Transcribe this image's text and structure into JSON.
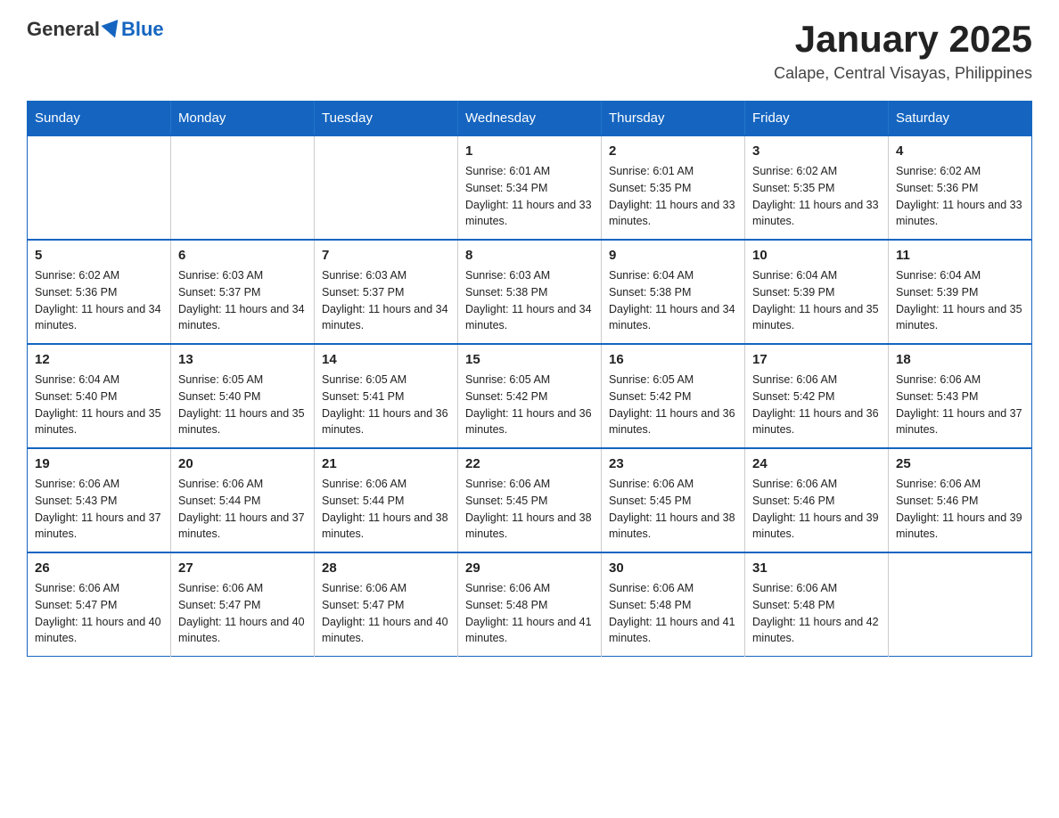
{
  "header": {
    "logo_text_general": "General",
    "logo_text_blue": "Blue",
    "main_title": "January 2025",
    "subtitle": "Calape, Central Visayas, Philippines"
  },
  "weekdays": [
    "Sunday",
    "Monday",
    "Tuesday",
    "Wednesday",
    "Thursday",
    "Friday",
    "Saturday"
  ],
  "weeks": [
    [
      {
        "day": "",
        "info": ""
      },
      {
        "day": "",
        "info": ""
      },
      {
        "day": "",
        "info": ""
      },
      {
        "day": "1",
        "info": "Sunrise: 6:01 AM\nSunset: 5:34 PM\nDaylight: 11 hours and 33 minutes."
      },
      {
        "day": "2",
        "info": "Sunrise: 6:01 AM\nSunset: 5:35 PM\nDaylight: 11 hours and 33 minutes."
      },
      {
        "day": "3",
        "info": "Sunrise: 6:02 AM\nSunset: 5:35 PM\nDaylight: 11 hours and 33 minutes."
      },
      {
        "day": "4",
        "info": "Sunrise: 6:02 AM\nSunset: 5:36 PM\nDaylight: 11 hours and 33 minutes."
      }
    ],
    [
      {
        "day": "5",
        "info": "Sunrise: 6:02 AM\nSunset: 5:36 PM\nDaylight: 11 hours and 34 minutes."
      },
      {
        "day": "6",
        "info": "Sunrise: 6:03 AM\nSunset: 5:37 PM\nDaylight: 11 hours and 34 minutes."
      },
      {
        "day": "7",
        "info": "Sunrise: 6:03 AM\nSunset: 5:37 PM\nDaylight: 11 hours and 34 minutes."
      },
      {
        "day": "8",
        "info": "Sunrise: 6:03 AM\nSunset: 5:38 PM\nDaylight: 11 hours and 34 minutes."
      },
      {
        "day": "9",
        "info": "Sunrise: 6:04 AM\nSunset: 5:38 PM\nDaylight: 11 hours and 34 minutes."
      },
      {
        "day": "10",
        "info": "Sunrise: 6:04 AM\nSunset: 5:39 PM\nDaylight: 11 hours and 35 minutes."
      },
      {
        "day": "11",
        "info": "Sunrise: 6:04 AM\nSunset: 5:39 PM\nDaylight: 11 hours and 35 minutes."
      }
    ],
    [
      {
        "day": "12",
        "info": "Sunrise: 6:04 AM\nSunset: 5:40 PM\nDaylight: 11 hours and 35 minutes."
      },
      {
        "day": "13",
        "info": "Sunrise: 6:05 AM\nSunset: 5:40 PM\nDaylight: 11 hours and 35 minutes."
      },
      {
        "day": "14",
        "info": "Sunrise: 6:05 AM\nSunset: 5:41 PM\nDaylight: 11 hours and 36 minutes."
      },
      {
        "day": "15",
        "info": "Sunrise: 6:05 AM\nSunset: 5:42 PM\nDaylight: 11 hours and 36 minutes."
      },
      {
        "day": "16",
        "info": "Sunrise: 6:05 AM\nSunset: 5:42 PM\nDaylight: 11 hours and 36 minutes."
      },
      {
        "day": "17",
        "info": "Sunrise: 6:06 AM\nSunset: 5:42 PM\nDaylight: 11 hours and 36 minutes."
      },
      {
        "day": "18",
        "info": "Sunrise: 6:06 AM\nSunset: 5:43 PM\nDaylight: 11 hours and 37 minutes."
      }
    ],
    [
      {
        "day": "19",
        "info": "Sunrise: 6:06 AM\nSunset: 5:43 PM\nDaylight: 11 hours and 37 minutes."
      },
      {
        "day": "20",
        "info": "Sunrise: 6:06 AM\nSunset: 5:44 PM\nDaylight: 11 hours and 37 minutes."
      },
      {
        "day": "21",
        "info": "Sunrise: 6:06 AM\nSunset: 5:44 PM\nDaylight: 11 hours and 38 minutes."
      },
      {
        "day": "22",
        "info": "Sunrise: 6:06 AM\nSunset: 5:45 PM\nDaylight: 11 hours and 38 minutes."
      },
      {
        "day": "23",
        "info": "Sunrise: 6:06 AM\nSunset: 5:45 PM\nDaylight: 11 hours and 38 minutes."
      },
      {
        "day": "24",
        "info": "Sunrise: 6:06 AM\nSunset: 5:46 PM\nDaylight: 11 hours and 39 minutes."
      },
      {
        "day": "25",
        "info": "Sunrise: 6:06 AM\nSunset: 5:46 PM\nDaylight: 11 hours and 39 minutes."
      }
    ],
    [
      {
        "day": "26",
        "info": "Sunrise: 6:06 AM\nSunset: 5:47 PM\nDaylight: 11 hours and 40 minutes."
      },
      {
        "day": "27",
        "info": "Sunrise: 6:06 AM\nSunset: 5:47 PM\nDaylight: 11 hours and 40 minutes."
      },
      {
        "day": "28",
        "info": "Sunrise: 6:06 AM\nSunset: 5:47 PM\nDaylight: 11 hours and 40 minutes."
      },
      {
        "day": "29",
        "info": "Sunrise: 6:06 AM\nSunset: 5:48 PM\nDaylight: 11 hours and 41 minutes."
      },
      {
        "day": "30",
        "info": "Sunrise: 6:06 AM\nSunset: 5:48 PM\nDaylight: 11 hours and 41 minutes."
      },
      {
        "day": "31",
        "info": "Sunrise: 6:06 AM\nSunset: 5:48 PM\nDaylight: 11 hours and 42 minutes."
      },
      {
        "day": "",
        "info": ""
      }
    ]
  ]
}
